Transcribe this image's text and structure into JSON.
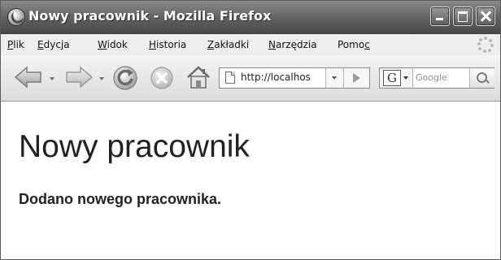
{
  "window": {
    "title": "Nowy pracownik - Mozilla Firefox"
  },
  "menu": {
    "items": [
      {
        "label": "Plik",
        "accesskey": "P"
      },
      {
        "label": "Edycja",
        "accesskey": "E"
      },
      {
        "label": "Widok",
        "accesskey": "W"
      },
      {
        "label": "Historia",
        "accesskey": "H"
      },
      {
        "label": "Zakładki",
        "accesskey": "Z"
      },
      {
        "label": "Narzędzia",
        "accesskey": "N"
      },
      {
        "label": "Pomoc",
        "accesskey": "c"
      }
    ]
  },
  "toolbar": {
    "icons": [
      "back-arrow-icon",
      "forward-arrow-icon",
      "reload-icon",
      "stop-icon",
      "home-icon"
    ],
    "url": "http://localhos",
    "search_placeholder": "Google",
    "search_engine_letter": "G"
  },
  "page": {
    "heading": "Nowy pracownik",
    "message": "Dodano nowego pracownika."
  },
  "colors": {
    "titlebar": "#5f5f5f",
    "menubar": "#eeeeee",
    "toolbar": "#dcdcdc",
    "text": "#222222"
  }
}
